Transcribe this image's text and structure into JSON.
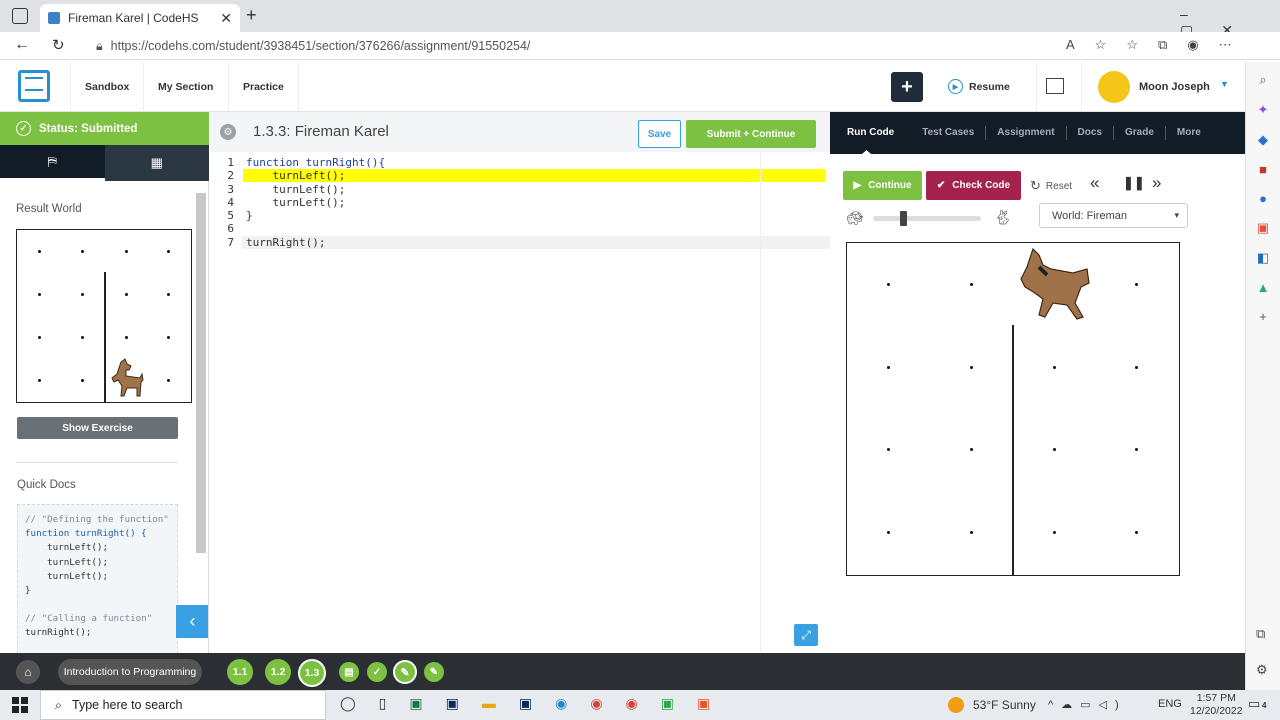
{
  "browser": {
    "tab_title": "Fireman Karel | CodeHS",
    "url": "https://codehs.com/student/3938451/section/376266/assignment/91550254/"
  },
  "header": {
    "nav": [
      "Sandbox",
      "My Section",
      "Practice"
    ],
    "resume_label": "Resume",
    "user_name": "Moon Joseph"
  },
  "sidebar": {
    "status": "Status: Submitted",
    "result_world_label": "Result World",
    "show_exercise_label": "Show Exercise",
    "quick_docs_label": "Quick Docs",
    "docs_code": [
      "// \"Defining the function\"",
      "function turnRight() {",
      "    turnLeft();",
      "    turnLeft();",
      "    turnLeft();",
      "}",
      "",
      "// \"Calling a function\"",
      "turnRight();"
    ]
  },
  "editor": {
    "title": "1.3.3: Fireman Karel",
    "save_label": "Save",
    "submit_label": "Submit + Continue",
    "lines": [
      {
        "num": "1",
        "text": "function turnRight(){"
      },
      {
        "num": "2",
        "text": "    turnLeft();"
      },
      {
        "num": "3",
        "text": "    turnLeft();"
      },
      {
        "num": "4",
        "text": "    turnLeft();"
      },
      {
        "num": "5",
        "text": "}"
      },
      {
        "num": "6",
        "text": ""
      },
      {
        "num": "7",
        "text": "turnRight();"
      }
    ],
    "highlighted_line": 2
  },
  "right_panel": {
    "tabs": [
      "Run Code",
      "Test Cases",
      "Assignment",
      "Docs",
      "Grade",
      "More"
    ],
    "continue_label": "Continue",
    "check_code_label": "Check Code",
    "reset_label": "Reset",
    "world_select": "World: Fireman"
  },
  "bottom_bar": {
    "course_label": "Introduction to Programming",
    "lessons": [
      "1.1",
      "1.2",
      "1.3"
    ]
  },
  "taskbar": {
    "search_placeholder": "Type here to search",
    "weather": "53°F  Sunny",
    "lang": "ENG",
    "time": "1:57 PM",
    "date": "12/20/2022",
    "notif_count": "4"
  },
  "colors": {
    "green": "#7cc142",
    "dark_nav": "#111c26",
    "check_code": "#a4224b",
    "highlight": "#ffff00",
    "blue_toggle": "#3aa0e4"
  }
}
